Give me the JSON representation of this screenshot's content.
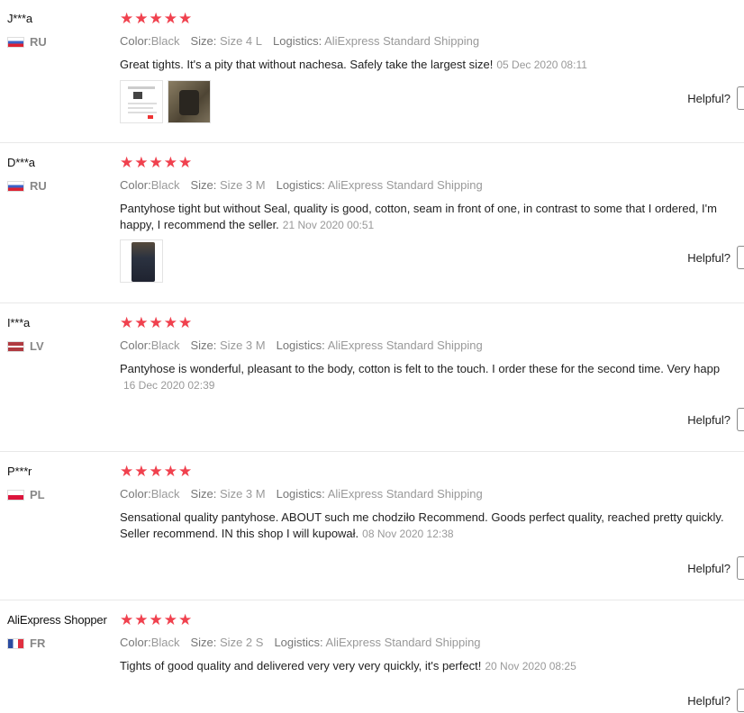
{
  "labels": {
    "color": "Color:",
    "size": "Size:",
    "logistics": "Logistics:",
    "helpful": "Helpful?"
  },
  "reviews": [
    {
      "user": "J***a",
      "country": "RU",
      "flag": "ru",
      "color": "Black",
      "size": "Size 4 L",
      "logistics": "AliExpress Standard Shipping",
      "text": "Great tights. It's a pity that without nachesa. Safely take the largest size!",
      "text2": "",
      "date": "05 Dec 2020 08:11",
      "photos": [
        "product-screenshot-thumb",
        "pantyhose-photo-thumb"
      ]
    },
    {
      "user": "D***a",
      "country": "RU",
      "flag": "ru",
      "color": "Black",
      "size": "Size 3 M",
      "logistics": "AliExpress Standard Shipping",
      "text": "Pantyhose tight but without Seal, quality is good, cotton, seam in front of one, in contrast to some that I ordered, I'm",
      "text2": "happy, I recommend the seller.",
      "date": "21 Nov 2020 00:51",
      "photos": [
        "package-photo-thumb"
      ]
    },
    {
      "user": "I***a",
      "country": "LV",
      "flag": "lv",
      "color": "Black",
      "size": "Size 3 M",
      "logistics": "AliExpress Standard Shipping",
      "text": "Pantyhose is wonderful, pleasant to the body, cotton is felt to the touch. I order these for the second time. Very happ",
      "text2": "",
      "date": "16 Dec 2020 02:39",
      "photos": []
    },
    {
      "user": "P***r",
      "country": "PL",
      "flag": "pl",
      "color": "Black",
      "size": "Size 3 M",
      "logistics": "AliExpress Standard Shipping",
      "text": "Sensational quality pantyhose. ABOUT such me chodziło Recommend. Goods perfect quality, reached pretty quickly.",
      "text2": "Seller recommend. IN this shop I will kupował.",
      "date": "08 Nov 2020 12:38",
      "photos": []
    },
    {
      "user": "AliExpress Shopper",
      "country": "FR",
      "flag": "fr",
      "color": "Black",
      "size": "Size 2 S",
      "logistics": "AliExpress Standard Shipping",
      "text": "Tights of good quality and delivered very very very quickly, it's perfect!",
      "text2": "",
      "date": "20 Nov 2020 08:25",
      "photos": []
    }
  ]
}
